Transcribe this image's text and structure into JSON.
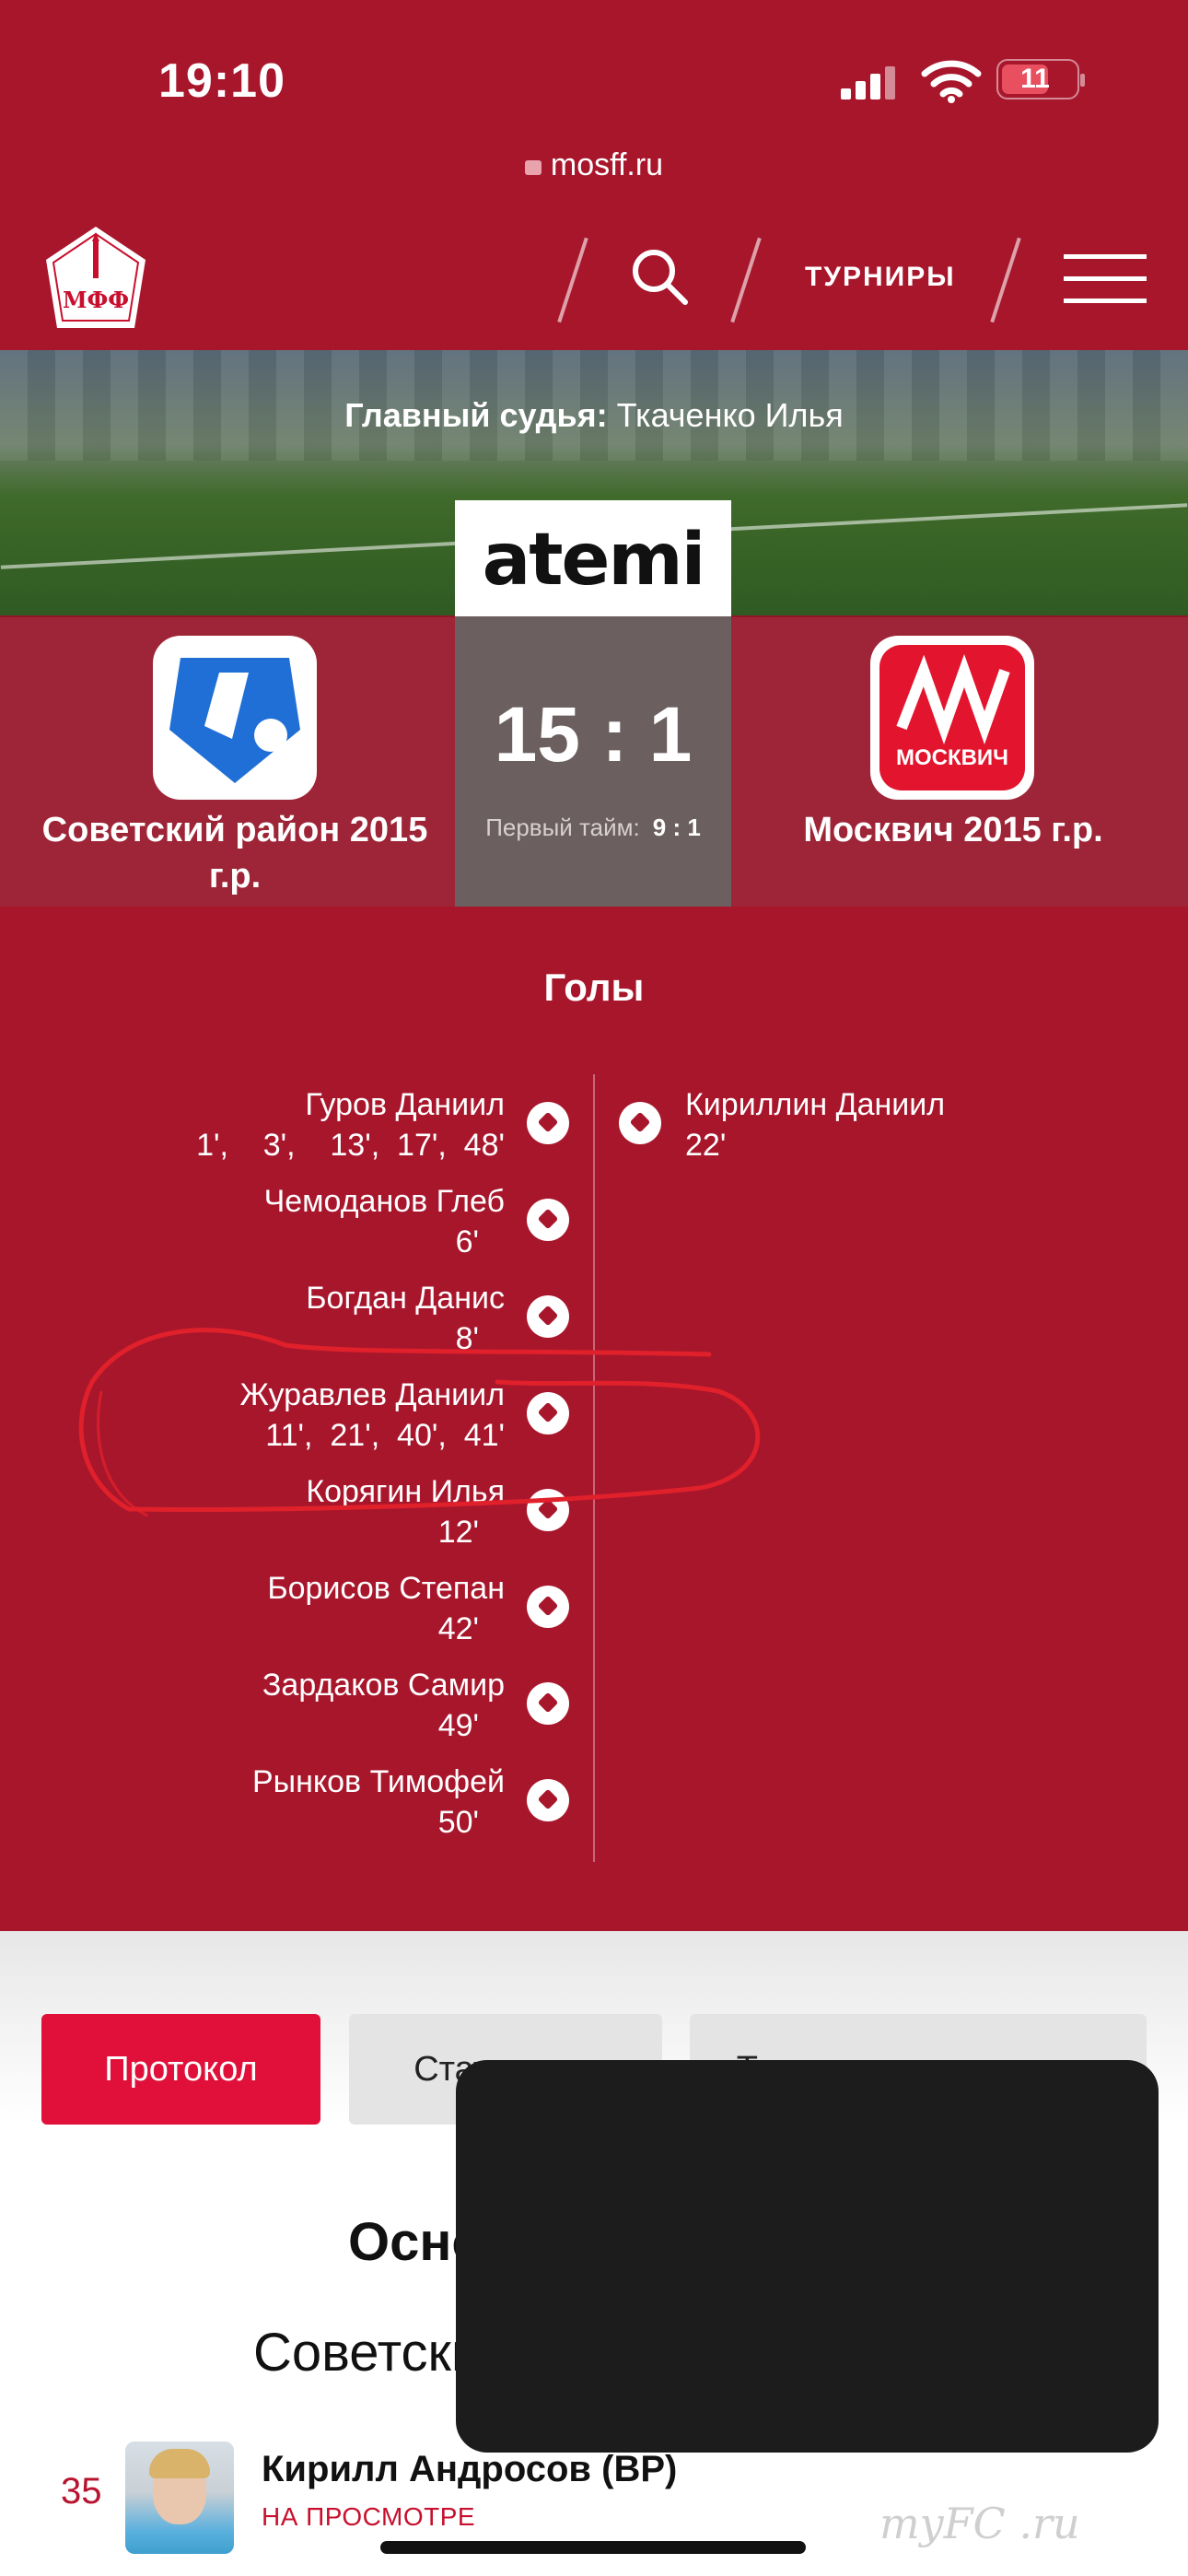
{
  "status_bar": {
    "time": "19:10",
    "battery": "11"
  },
  "browser": {
    "url": "mosff.ru"
  },
  "nav": {
    "logo_text": "МФФ",
    "tournaments_label": "ТУРНИРЫ"
  },
  "match": {
    "referee_label": "Главный судья:",
    "referee_name": "Ткаченко Илья",
    "sponsor": "atemi",
    "home_team": "Советский район 2015 г.р.",
    "away_team": "Москвич 2015 г.р.",
    "away_logo_text": "МОСКВИЧ",
    "score": "15 : 1",
    "first_half_label": "Первый тайм:",
    "first_half_score": "9 : 1"
  },
  "goals": {
    "title": "Голы",
    "home": [
      {
        "name": "Гуров Даниил",
        "minutes": "1',    3',    13',  17',  48'"
      },
      {
        "name": "Чемоданов Глеб",
        "minutes": "6'"
      },
      {
        "name": "Богдан Данис",
        "minutes": "8'"
      },
      {
        "name": "Журавлев Даниил",
        "minutes": "11',  21',  40',  41'"
      },
      {
        "name": "Корягин Илья",
        "minutes": "12'"
      },
      {
        "name": "Борисов Степан",
        "minutes": "42'"
      },
      {
        "name": "Зардаков Самир",
        "minutes": "49'"
      },
      {
        "name": "Рынков Тимофей",
        "minutes": "50'"
      }
    ],
    "away": [
      {
        "name": "Кириллин Даниил",
        "minutes": "22'"
      }
    ]
  },
  "tabs": [
    {
      "label": "Протокол",
      "active": true
    },
    {
      "label": "Статистика",
      "active": false
    },
    {
      "label": "Текстовая трансляция",
      "active": false
    }
  ],
  "lineup": {
    "section_title": "Основной состав",
    "team_title": "Советский район 2015 г.р.",
    "player": {
      "number": "35",
      "name": "Кирилл Андросов (ВР)",
      "status": "НА ПРОСМОТРЕ"
    }
  },
  "watermark": "myFC .ru",
  "colors": {
    "brand": "#a8162c",
    "accent": "#e0103a"
  }
}
